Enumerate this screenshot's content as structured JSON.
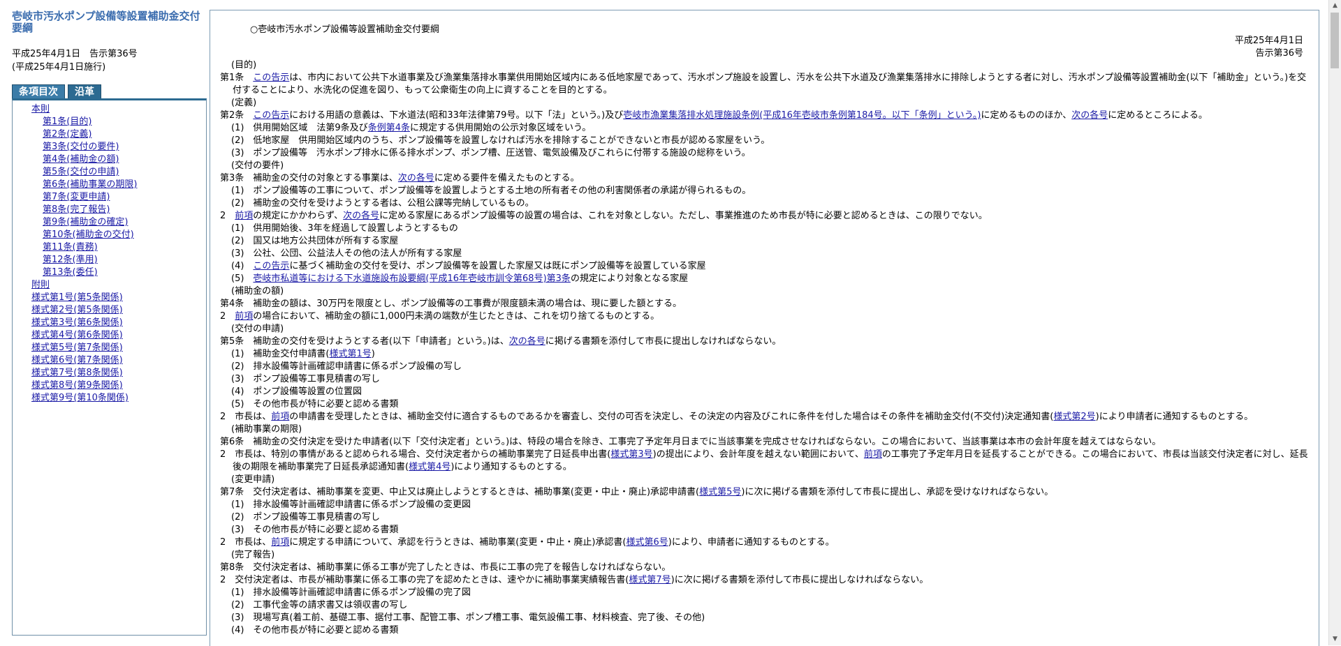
{
  "sidebar": {
    "title": "壱岐市汚水ポンプ設備等設置補助金交付要綱",
    "promulgation": "平成25年4月1日　告示第36号",
    "enforcement": "(平成25年4月1日施行)",
    "tabs": [
      "条項目次",
      "沿革"
    ],
    "toc": [
      {
        "label": "本則",
        "level": 0
      },
      {
        "label": "第1条(目的)",
        "level": 1
      },
      {
        "label": "第2条(定義)",
        "level": 1
      },
      {
        "label": "第3条(交付の要件)",
        "level": 1
      },
      {
        "label": "第4条(補助金の額)",
        "level": 1
      },
      {
        "label": "第5条(交付の申請)",
        "level": 1
      },
      {
        "label": "第6条(補助事業の期限)",
        "level": 1
      },
      {
        "label": "第7条(変更申請)",
        "level": 1
      },
      {
        "label": "第8条(完了報告)",
        "level": 1
      },
      {
        "label": "第9条(補助金の確定)",
        "level": 1
      },
      {
        "label": "第10条(補助金の交付)",
        "level": 1
      },
      {
        "label": "第11条(責務)",
        "level": 1
      },
      {
        "label": "第12条(準用)",
        "level": 1
      },
      {
        "label": "第13条(委任)",
        "level": 1
      },
      {
        "label": "附則",
        "level": 0
      },
      {
        "label": "様式第1号(第5条関係)",
        "level": 0
      },
      {
        "label": "様式第2号(第5条関係)",
        "level": 0
      },
      {
        "label": "様式第3号(第6条関係)",
        "level": 0
      },
      {
        "label": "様式第4号(第6条関係)",
        "level": 0
      },
      {
        "label": "様式第5号(第7条関係)",
        "level": 0
      },
      {
        "label": "様式第6号(第7条関係)",
        "level": 0
      },
      {
        "label": "様式第7号(第8条関係)",
        "level": 0
      },
      {
        "label": "様式第8号(第9条関係)",
        "level": 0
      },
      {
        "label": "様式第9号(第10条関係)",
        "level": 0
      }
    ]
  },
  "main": {
    "title": "○壱岐市汚水ポンプ設備等設置補助金交付要綱",
    "date": "平成25年4月1日",
    "notice": "告示第36号",
    "text": {
      "h1": "(目的)",
      "a1_pre": "第1条　",
      "a1_link": "この告示",
      "a1_post": "は、市内において公共下水道事業及び漁業集落排水事業供用開始区域内にある低地家屋であって、汚水ポンプ施設を設置し、汚水を公共下水道及び漁業集落排水に排除しようとする者に対し、汚水ポンプ設備等設置補助金(以下「補助金」という。)を交付することにより、水洗化の促進を図り、もって公衆衛生の向上に資することを目的とする。",
      "h2": "(定義)",
      "a2_pre": "第2条　",
      "a2_link1": "この告示",
      "a2_mid1": "における用語の意義は、下水道法(昭和33年法律第79号。以下「法」という。)及び",
      "a2_link2": "壱岐市漁業集落排水処理施設条例(平成16年壱岐市条例第184号。以下「条例」という。)",
      "a2_mid2": "に定めるもののほか、",
      "a2_link3": "次の各号",
      "a2_post": "に定めるところによる。",
      "a2_1_pre": "(1)　供用開始区域　法第9条及び",
      "a2_1_link": "条例第4条",
      "a2_1_post": "に規定する供用開始の公示対象区域をいう。",
      "a2_2": "(2)　低地家屋　供用開始区域内のうち、ポンプ設備等を設置しなければ汚水を排除することができないと市長が認める家屋をいう。",
      "a2_3": "(3)　ポンプ設備等　汚水ポンプ排水に係る排水ポンプ、ポンプ槽、圧送管、電気設備及びこれらに付帯する施設の総称をいう。",
      "h3": "(交付の要件)",
      "a3_pre": "第3条　補助金の交付の対象とする事業は、",
      "a3_link": "次の各号",
      "a3_post": "に定める要件を備えたものとする。",
      "a3_1": "(1)　ポンプ設備等の工事について、ポンプ設備等を設置しようとする土地の所有者その他の利害関係者の承諾が得られるもの。",
      "a3_2": "(2)　補助金の交付を受けようとする者は、公租公課等完納しているもの。",
      "a3_p2_pre": "2　",
      "a3_p2_link1": "前項",
      "a3_p2_mid": "の規定にかかわらず、",
      "a3_p2_link2": "次の各号",
      "a3_p2_post": "に定める家屋にあるポンプ設備等の設置の場合は、これを対象としない。ただし、事業推進のため市長が特に必要と認めるときは、この限りでない。",
      "a3_p2_1": "(1)　供用開始後、3年を経過して設置しようとするもの",
      "a3_p2_2": "(2)　国又は地方公共団体が所有する家屋",
      "a3_p2_3": "(3)　公社、公団、公益法人その他の法人が所有する家屋",
      "a3_p2_4_pre": "(4)　",
      "a3_p2_4_link": "この告示",
      "a3_p2_4_post": "に基づく補助金の交付を受け、ポンプ設備等を設置した家屋又は既にポンプ設備等を設置している家屋",
      "a3_p2_5_pre": "(5)　",
      "a3_p2_5_link1": "壱岐市私道等における下水道施設布設要綱(平成16年壱岐市訓令第68号)",
      "a3_p2_5_link2": "第3条",
      "a3_p2_5_post": "の規定により対象となる家屋",
      "h4": "(補助金の額)",
      "a4": "第4条　補助金の額は、30万円を限度とし、ポンプ設備等の工事費が限度額未満の場合は、現に要した額とする。",
      "a4_p2_pre": "2　",
      "a4_p2_link": "前項",
      "a4_p2_post": "の場合において、補助金の額に1,000円未満の端数が生じたときは、これを切り捨てるものとする。",
      "h5": "(交付の申請)",
      "a5_pre": "第5条　補助金の交付を受けようとする者(以下「申請者」という。)は、",
      "a5_link": "次の各号",
      "a5_post": "に掲げる書類を添付して市長に提出しなければならない。",
      "a5_1_pre": "(1)　補助金交付申請書(",
      "a5_1_link": "様式第1号",
      "a5_1_post": ")",
      "a5_2": "(2)　排水設備等計画確認申請書に係るポンプ設備の写し",
      "a5_3": "(3)　ポンプ設備等工事見積書の写し",
      "a5_4": "(4)　ポンプ設備等設置の位置図",
      "a5_5": "(5)　その他市長が特に必要と認める書類",
      "a5_p2_pre": "2　市長は、",
      "a5_p2_link1": "前項",
      "a5_p2_mid": "の申請書を受理したときは、補助金交付に適合するものであるかを審査し、交付の可否を決定し、その決定の内容及びこれに条件を付した場合はその条件を補助金交付(不交付)決定通知書(",
      "a5_p2_link2": "様式第2号",
      "a5_p2_post": ")により申請者に通知するものとする。",
      "h6": "(補助事業の期限)",
      "a6": "第6条　補助金の交付決定を受けた申請者(以下「交付決定者」という。)は、特段の場合を除き、工事完了予定年月日までに当該事業を完成させなければならない。この場合において、当該事業は本市の会計年度を越えてはならない。",
      "a6_p2_pre": "2　市長は、特別の事情があると認められる場合、交付決定者からの補助事業完了日延長申出書(",
      "a6_p2_link1": "様式第3号",
      "a6_p2_mid1": ")の提出により、会計年度を越えない範囲において、",
      "a6_p2_link2": "前項",
      "a6_p2_mid2": "の工事完了予定年月日を延長することができる。この場合において、市長は当該交付決定者に対し、延長後の期限を補助事業完了日延長承認通知書(",
      "a6_p2_link3": "様式第4号",
      "a6_p2_post": ")により通知するものとする。",
      "h7": "(変更申請)",
      "a7_pre": "第7条　交付決定者は、補助事業を変更、中止又は廃止しようとするときは、補助事業(変更・中止・廃止)承認申請書(",
      "a7_link": "様式第5号",
      "a7_post": ")に次に掲げる書類を添付して市長に提出し、承認を受けなければならない。",
      "a7_1": "(1)　排水設備等計画確認申請書に係るポンプ設備の変更図",
      "a7_2": "(2)　ポンプ設備等工事見積書の写し",
      "a7_3": "(3)　その他市長が特に必要と認める書類",
      "a7_p2_pre": "2　市長は、",
      "a7_p2_link1": "前項",
      "a7_p2_mid": "に規定する申請について、承認を行うときは、補助事業(変更・中止・廃止)承認書(",
      "a7_p2_link2": "様式第6号",
      "a7_p2_post": ")により、申請者に通知するものとする。",
      "h8": "(完了報告)",
      "a8": "第8条　交付決定者は、補助事業に係る工事が完了したときは、市長に工事の完了を報告しなければならない。",
      "a8_p2_pre": "2　交付決定者は、市長が補助事業に係る工事の完了を認めたときは、速やかに補助事業実績報告書(",
      "a8_p2_link": "様式第7号",
      "a8_p2_post": ")に次に掲げる書類を添付して市長に提出しなければならない。",
      "a8_1": "(1)　排水設備等計画確認申請書に係るポンプ設備の完了図",
      "a8_2": "(2)　工事代金等の請求書又は領収書の写し",
      "a8_3": "(3)　現場写真(着工前、基礎工事、据付工事、配管工事、ポンプ槽工事、電気設備工事、材料検査、完了後、その他)",
      "a8_4": "(4)　その他市長が特に必要と認める書類"
    }
  }
}
